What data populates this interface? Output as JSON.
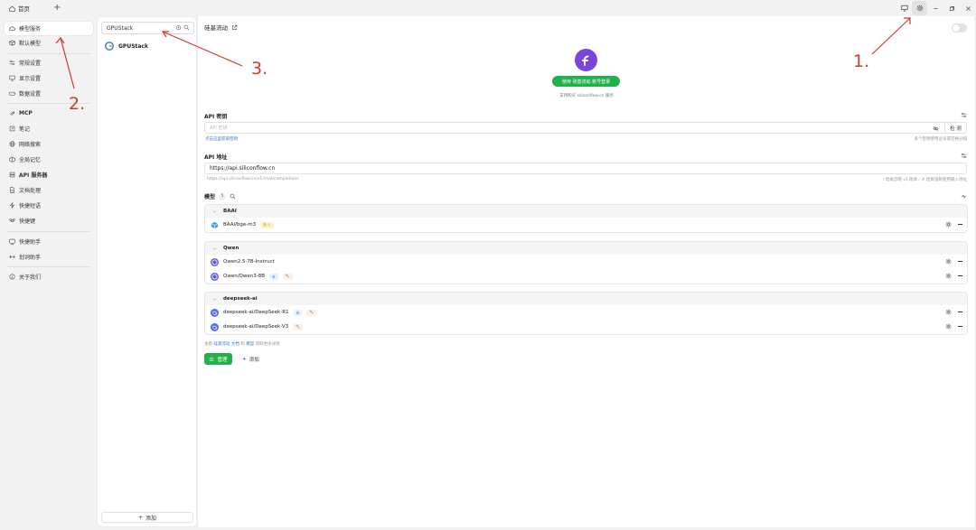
{
  "tabbar": {
    "home_label": "首页",
    "new_tab_symbol": "+"
  },
  "sidebar": {
    "items": [
      {
        "label": "模型服务",
        "icon": "cloud-icon"
      },
      {
        "label": "默认模型",
        "icon": "cube-icon"
      },
      {
        "label": "常规设置",
        "icon": "sliders-icon"
      },
      {
        "label": "显示设置",
        "icon": "monitor-icon"
      },
      {
        "label": "数据设置",
        "icon": "hard-drive-icon"
      },
      {
        "label": "MCP",
        "icon": "mcp-icon"
      },
      {
        "label": "笔记",
        "icon": "note-icon"
      },
      {
        "label": "网络搜索",
        "icon": "globe-icon"
      },
      {
        "label": "全局记忆",
        "icon": "brain-icon"
      },
      {
        "label": "API 服务器",
        "icon": "server-icon"
      },
      {
        "label": "文档处理",
        "icon": "document-icon"
      },
      {
        "label": "快捷短语",
        "icon": "zap-icon"
      },
      {
        "label": "快捷键",
        "icon": "command-icon"
      },
      {
        "label": "快捷助手",
        "icon": "assistant-icon"
      },
      {
        "label": "划词助手",
        "icon": "text-select-icon"
      },
      {
        "label": "关于我们",
        "icon": "info-icon"
      }
    ]
  },
  "provider_panel": {
    "search_value": "GPUStack",
    "providers": [
      {
        "name": "GPUStack",
        "icon": "gpustack-logo-icon"
      }
    ],
    "add_label": "添加"
  },
  "provider": {
    "title": "硅基流动",
    "login_button": "使用 硅基流动 账号登录",
    "login_note": "支持购买 siliconflow.cn 服务",
    "api_key": {
      "title": "API 密钥",
      "placeholder": "API 密钥",
      "check_button": "检 测",
      "link_text": "点击这里获取密钥",
      "hint_right": "多个密钥使用逗号或空格分隔"
    },
    "api_address": {
      "title": "API 地址",
      "value": "https://api.siliconflow.cn",
      "preview": "https://api.siliconflow.cn/v1/chat/completions",
      "hint_right": "/ 结尾忽略 v1 版本，# 结尾强制使用输入地址"
    },
    "models": {
      "title": "模型",
      "count": "5",
      "groups": [
        {
          "name": "BAAI",
          "models": [
            {
              "name": "BAAI/bge-m3",
              "tags": [
                {
                  "type": "embed",
                  "text": "嵌入"
                }
              ]
            }
          ]
        },
        {
          "name": "Qwen",
          "models": [
            {
              "name": "Qwen2.5-7B-Instruct",
              "tags": []
            },
            {
              "name": "Qwen/Qwen3-8B",
              "tags": [
                {
                  "type": "vision",
                  "text": "⚙"
                },
                {
                  "type": "tool",
                  "text": "🔧"
                }
              ]
            }
          ]
        },
        {
          "name": "deepseek-ai",
          "models": [
            {
              "name": "deepseek-ai/DeepSeek-R1",
              "tags": [
                {
                  "type": "vision",
                  "text": "⚙"
                },
                {
                  "type": "tool",
                  "text": "🔧"
                }
              ]
            },
            {
              "name": "deepseek-ai/DeepSeek-V3",
              "tags": [
                {
                  "type": "tool",
                  "text": "🔧"
                }
              ]
            }
          ]
        }
      ],
      "footer_prefix": "查看",
      "footer_link1": "硅基流动 文档",
      "footer_mid": "和",
      "footer_link2": "模型",
      "footer_suffix": "获取更多详情",
      "manage_label": "管理",
      "add_label": "添加"
    }
  },
  "annotations": [
    {
      "label": "1."
    },
    {
      "label": "2."
    },
    {
      "label": "3."
    }
  ],
  "colors": {
    "accent_green": "#22b04b",
    "annotation_red": "#d03a2f",
    "logo_purple": "#7b45d8"
  }
}
